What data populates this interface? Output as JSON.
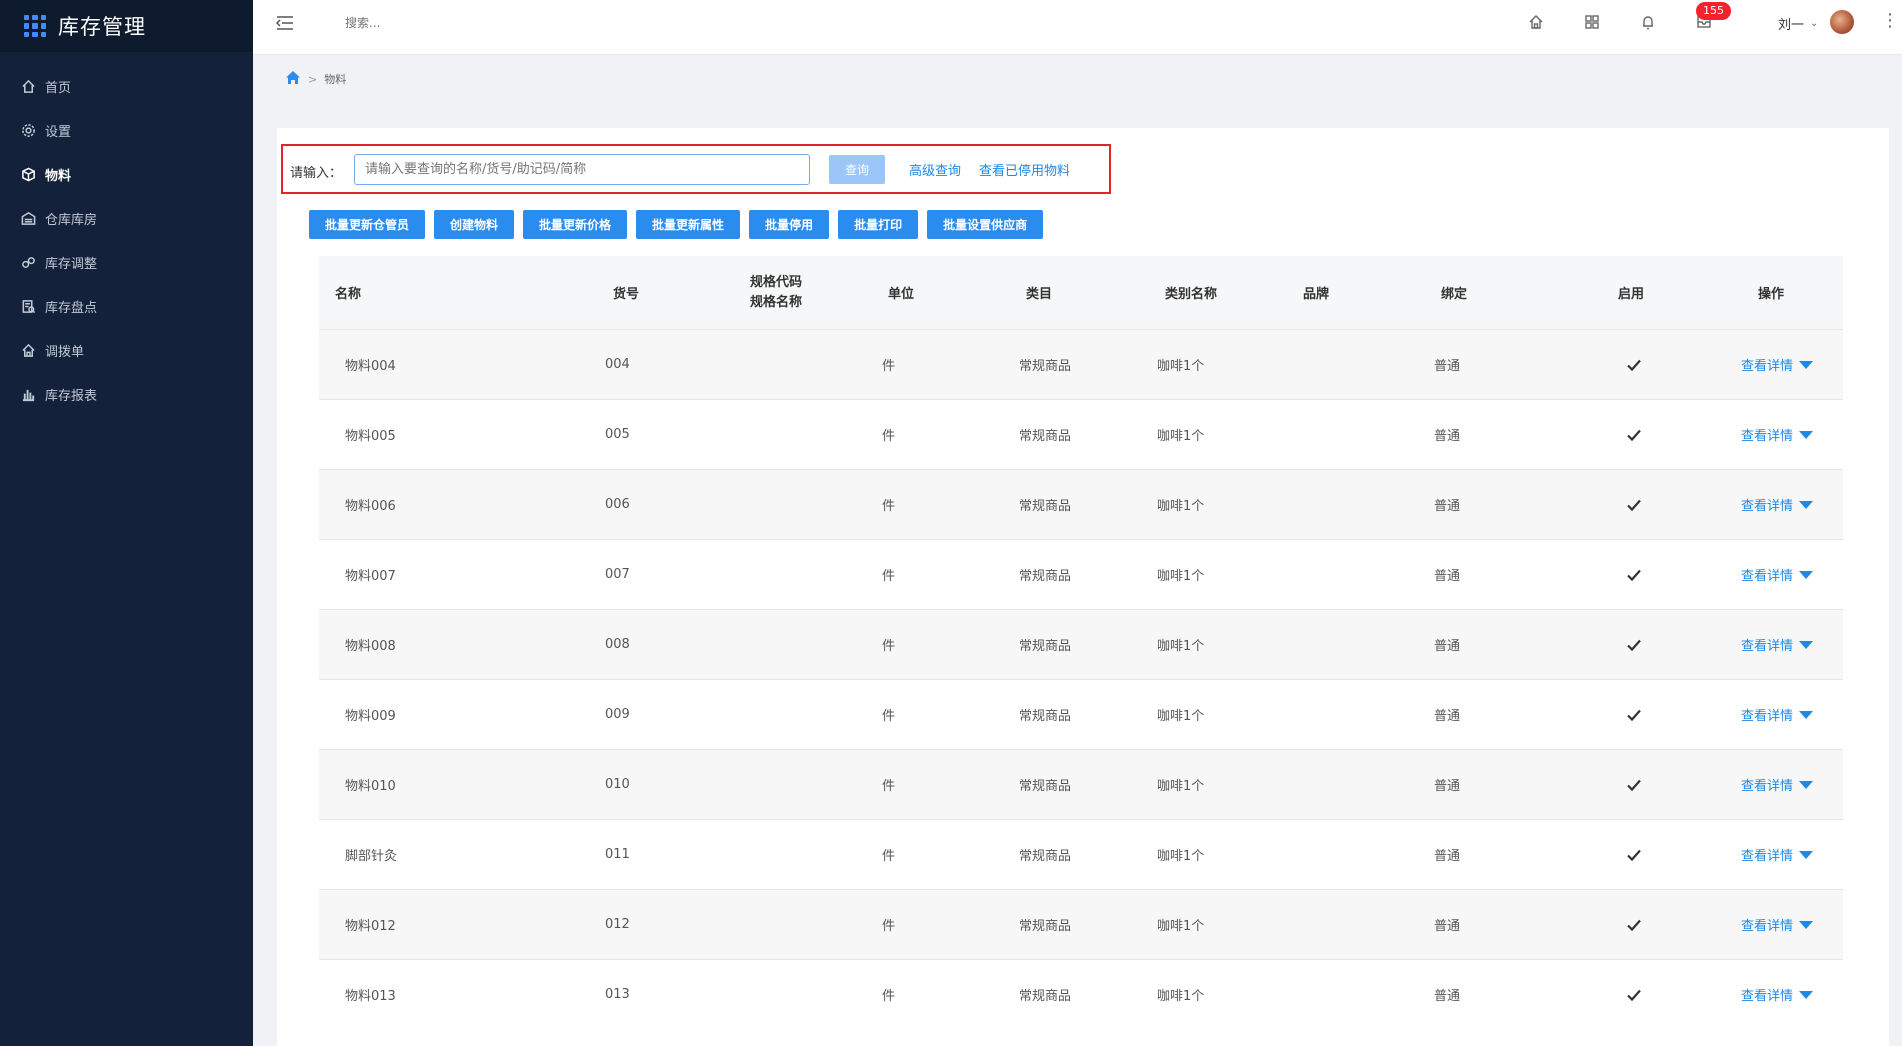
{
  "app": {
    "title": "库存管理"
  },
  "sidebar": {
    "items": [
      {
        "label": "首页",
        "icon": "home-icon"
      },
      {
        "label": "设置",
        "icon": "gear-icon"
      },
      {
        "label": "物料",
        "icon": "box-icon"
      },
      {
        "label": "仓库库房",
        "icon": "warehouse-icon"
      },
      {
        "label": "库存调整",
        "icon": "adjust-icon"
      },
      {
        "label": "库存盘点",
        "icon": "inventory-check-icon"
      },
      {
        "label": "调拨单",
        "icon": "transfer-icon"
      },
      {
        "label": "库存报表",
        "icon": "bar-chart-icon"
      }
    ],
    "active_index": 2
  },
  "header": {
    "search_placeholder": "搜索...",
    "notification_badge": "155",
    "user_name": "刘一"
  },
  "breadcrumb": {
    "current": "物料"
  },
  "search": {
    "label": "请输入：",
    "placeholder": "请输入要查询的名称/货号/助记码/简称",
    "query_button": "查询",
    "advanced_link": "高级查询",
    "disabled_link": "查看已停用物料"
  },
  "toolbar": {
    "buttons": [
      "批量更新仓管员",
      "创建物料",
      "批量更新价格",
      "批量更新属性",
      "批量停用",
      "批量打印",
      "批量设置供应商"
    ]
  },
  "table": {
    "headers": {
      "name": "名称",
      "code": "货号",
      "spec_code": "规格代码",
      "spec_name": "规格名称",
      "unit": "单位",
      "category": "类目",
      "category_name": "类别名称",
      "brand": "品牌",
      "binding": "绑定",
      "enabled": "启用",
      "action": "操作"
    },
    "action_label": "查看详情",
    "rows": [
      {
        "name": "物料004",
        "code": "004",
        "unit": "件",
        "category": "常规商品",
        "category_name": "咖啡1个",
        "binding": "普通",
        "enabled": true
      },
      {
        "name": "物料005",
        "code": "005",
        "unit": "件",
        "category": "常规商品",
        "category_name": "咖啡1个",
        "binding": "普通",
        "enabled": true
      },
      {
        "name": "物料006",
        "code": "006",
        "unit": "件",
        "category": "常规商品",
        "category_name": "咖啡1个",
        "binding": "普通",
        "enabled": true
      },
      {
        "name": "物料007",
        "code": "007",
        "unit": "件",
        "category": "常规商品",
        "category_name": "咖啡1个",
        "binding": "普通",
        "enabled": true
      },
      {
        "name": "物料008",
        "code": "008",
        "unit": "件",
        "category": "常规商品",
        "category_name": "咖啡1个",
        "binding": "普通",
        "enabled": true
      },
      {
        "name": "物料009",
        "code": "009",
        "unit": "件",
        "category": "常规商品",
        "category_name": "咖啡1个",
        "binding": "普通",
        "enabled": true
      },
      {
        "name": "物料010",
        "code": "010",
        "unit": "件",
        "category": "常规商品",
        "category_name": "咖啡1个",
        "binding": "普通",
        "enabled": true
      },
      {
        "name": "脚部针灸",
        "code": "011",
        "unit": "件",
        "category": "常规商品",
        "category_name": "咖啡1个",
        "binding": "普通",
        "enabled": true
      },
      {
        "name": "物料012",
        "code": "012",
        "unit": "件",
        "category": "常规商品",
        "category_name": "咖啡1个",
        "binding": "普通",
        "enabled": true
      },
      {
        "name": "物料013",
        "code": "013",
        "unit": "件",
        "category": "常规商品",
        "category_name": "咖啡1个",
        "binding": "普通",
        "enabled": true
      }
    ]
  }
}
